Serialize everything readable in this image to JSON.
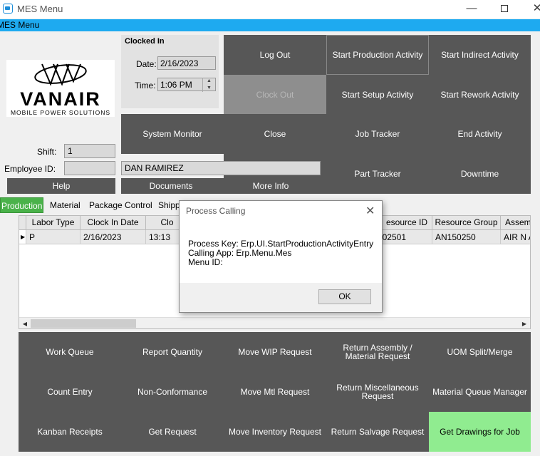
{
  "window": {
    "title": "MES Menu",
    "minimize": "—",
    "close": "✕"
  },
  "menustrip": {
    "label": "MES Menu"
  },
  "logo": {
    "brand": "VANAIR",
    "tagline": "MOBILE POWER SOLUTIONS"
  },
  "clock": {
    "title": "Clocked In",
    "date_label": "Date:",
    "date_value": "2/16/2023",
    "time_label": "Time:",
    "time_value": "1:06 PM"
  },
  "top_actions": {
    "log_out": "Log Out",
    "clock_out": "Clock Out",
    "system_monitor": "System Monitor",
    "close": "Close",
    "start_production": "Start Production Activity",
    "start_indirect": "Start Indirect Activity",
    "start_setup": "Start Setup Activity",
    "start_rework": "Start Rework Activity",
    "job_tracker": "Job Tracker",
    "end_activity": "End Activity",
    "part_tracker": "Part Tracker",
    "downtime": "Downtime"
  },
  "employee": {
    "shift_label": "Shift:",
    "shift_value": "1",
    "employee_id_label": "Employee ID:",
    "employee_id_value": "",
    "employee_name": "DAN RAMIREZ",
    "help": "Help",
    "documents": "Documents",
    "more_info": "More Info"
  },
  "tabs": [
    "Production",
    "Material",
    "Package Control",
    "Shipp"
  ],
  "grid": {
    "columns": [
      "Labor Type",
      "Clock In Date",
      "Clo",
      "esource ID",
      "Resource Group",
      "Assem"
    ],
    "row": [
      "P",
      "2/16/2023",
      "13:13",
      "02501",
      "AN150250",
      "AIR N A"
    ]
  },
  "dialog": {
    "title": "Process Calling",
    "process_key": "Process Key: Erp.UI.StartProductionActivityEntry",
    "calling_app": "Calling App: Erp.Menu.Mes",
    "menu_id": "Menu ID:",
    "ok": "OK"
  },
  "bottom_actions": {
    "work_queue": "Work Queue",
    "report_quantity": "Report Quantity",
    "move_wip": "Move WIP Request",
    "return_assembly": "Return Assembly / Material Request",
    "uom_split": "UOM Split/Merge",
    "count_entry": "Count Entry",
    "non_conformance": "Non-Conformance",
    "move_mtl": "Move Mtl Request",
    "return_misc": "Return Miscellaneous Request",
    "material_queue": "Material Queue Manager",
    "kanban": "Kanban Receipts",
    "get_request": "Get Request",
    "move_inventory": "Move Inventory Request",
    "return_salvage": "Return Salvage Request",
    "get_drawings": "Get Drawings for Job"
  },
  "colors": {
    "tile": "#575757",
    "accent_blue": "#1eaaf0",
    "active_tab": "#4ab24a",
    "highlight_green": "#90ec90"
  }
}
